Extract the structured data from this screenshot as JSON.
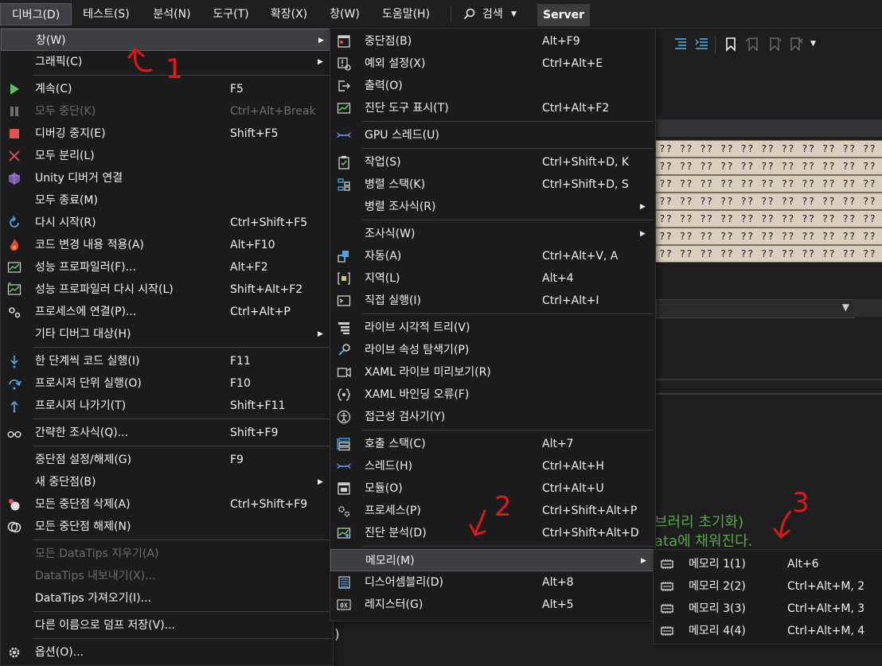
{
  "menubar": [
    {
      "label": "디버그(D)",
      "active": true
    },
    {
      "label": "테스트(S)"
    },
    {
      "label": "분석(N)"
    },
    {
      "label": "도구(T)"
    },
    {
      "label": "확장(X)"
    },
    {
      "label": "창(W)"
    },
    {
      "label": "도움말(H)"
    }
  ],
  "search_label": "검색",
  "server_label": "Server",
  "background": {
    "mem_row_text": "?? ?? ?? ?? ?? ?? ?? ?? ?? ?? ?? ?? ?? ?? ?? ?? ?? ?? ??",
    "green_line1": "브러리 초기화)",
    "green_line2": "ata에 채워진다.",
    "paren": ")"
  },
  "debug_menu": [
    {
      "label": "창(W)",
      "arrow": true,
      "highlight": true,
      "icon": ""
    },
    {
      "label": "그래픽(C)",
      "arrow": true,
      "icon": ""
    },
    {
      "sep": true
    },
    {
      "label": "계속(C)",
      "key": "F5",
      "icon": "play-icon"
    },
    {
      "label": "모두 중단(K)",
      "key": "Ctrl+Alt+Break",
      "icon": "pause-icon",
      "disabled": true
    },
    {
      "label": "디버깅 중지(E)",
      "key": "Shift+F5",
      "icon": "stop-icon"
    },
    {
      "label": "모두 분리(L)",
      "key": "",
      "icon": "detach-icon"
    },
    {
      "label": "Unity 디버거 연결",
      "key": "",
      "icon": "unity-cube-icon"
    },
    {
      "label": "모두 종료(M)",
      "key": "",
      "icon": ""
    },
    {
      "label": "다시 시작(R)",
      "key": "Ctrl+Shift+F5",
      "icon": "restart-icon"
    },
    {
      "label": "코드 변경 내용 적용(A)",
      "key": "Alt+F10",
      "icon": "hot-reload-flame-icon"
    },
    {
      "label": "성능 프로파일러(F)...",
      "key": "Alt+F2",
      "icon": "profiler-icon"
    },
    {
      "label": "성능 프로파일러 다시 시작(L)",
      "key": "Shift+Alt+F2",
      "icon": "profiler-restart-icon"
    },
    {
      "label": "프로세스에 연결(P)...",
      "key": "Ctrl+Alt+P",
      "icon": "attach-gears-icon"
    },
    {
      "label": "기타 디버그 대상(H)",
      "arrow": true,
      "icon": ""
    },
    {
      "sep": true
    },
    {
      "label": "한 단계씩 코드 실행(I)",
      "key": "F11",
      "icon": "step-into-icon"
    },
    {
      "label": "프로시저 단위 실행(O)",
      "key": "F10",
      "icon": "step-over-icon"
    },
    {
      "label": "프로시저 나가기(T)",
      "key": "Shift+F11",
      "icon": "step-out-icon"
    },
    {
      "sep": true
    },
    {
      "label": "간략한 조사식(Q)...",
      "key": "Shift+F9",
      "icon": "glasses-icon"
    },
    {
      "sep": true
    },
    {
      "label": "중단점 설정/해제(G)",
      "key": "F9",
      "icon": ""
    },
    {
      "label": "새 중단점(B)",
      "arrow": true,
      "icon": ""
    },
    {
      "label": "모든 중단점 삭제(A)",
      "key": "Ctrl+Shift+F9",
      "icon": "delete-breakpoints-icon"
    },
    {
      "label": "모든 중단점 해제(N)",
      "key": "",
      "icon": "disable-breakpoints-icon"
    },
    {
      "sep": true
    },
    {
      "label": "모든 DataTips 지우기(A)",
      "key": "",
      "icon": "",
      "disabled": true
    },
    {
      "label": "DataTips 내보내기(X)...",
      "key": "",
      "icon": "",
      "disabled": true
    },
    {
      "label": "DataTips 가져오기(I)...",
      "key": "",
      "icon": ""
    },
    {
      "sep": true
    },
    {
      "label": "다른 이름으로 덤프 저장(V)...",
      "key": "",
      "icon": ""
    },
    {
      "sep": true
    },
    {
      "label": "옵션(O)...",
      "key": "",
      "icon": "settings-gear-icon"
    }
  ],
  "window_menu": [
    {
      "label": "중단점(B)",
      "key": "Alt+F9",
      "icon": "breakpoints-window-icon"
    },
    {
      "label": "예외 설정(X)",
      "key": "Ctrl+Alt+E",
      "icon": "exception-settings-icon"
    },
    {
      "label": "출력(O)",
      "key": "",
      "icon": "output-icon"
    },
    {
      "label": "진단 도구 표시(T)",
      "key": "Ctrl+Alt+F2",
      "icon": "diagnostic-tools-icon"
    },
    {
      "sep": true
    },
    {
      "label": "GPU 스레드(U)",
      "key": "",
      "icon": "gpu-threads-icon"
    },
    {
      "sep": true
    },
    {
      "label": "작업(S)",
      "key": "Ctrl+Shift+D, K",
      "icon": "tasks-icon"
    },
    {
      "label": "병렬 스택(K)",
      "key": "Ctrl+Shift+D, S",
      "icon": "parallel-stacks-icon"
    },
    {
      "label": "병렬 조사식(R)",
      "arrow": true,
      "icon": ""
    },
    {
      "sep": true
    },
    {
      "label": "조사식(W)",
      "arrow": true,
      "icon": ""
    },
    {
      "label": "자동(A)",
      "key": "Ctrl+Alt+V, A",
      "icon": "autos-icon"
    },
    {
      "label": "지역(L)",
      "key": "Alt+4",
      "icon": "locals-icon"
    },
    {
      "label": "직접 실행(I)",
      "key": "Ctrl+Alt+I",
      "icon": "immediate-window-icon"
    },
    {
      "sep": true
    },
    {
      "label": "라이브 시각적 트리(V)",
      "key": "",
      "icon": "live-visual-tree-icon"
    },
    {
      "label": "라이브 속성 탐색기(P)",
      "key": "",
      "icon": "property-explorer-icon"
    },
    {
      "label": "XAML 라이브 미리보기(R)",
      "key": "",
      "icon": "xaml-preview-icon"
    },
    {
      "label": "XAML 바인딩 오류(F)",
      "key": "",
      "icon": "xaml-binding-icon"
    },
    {
      "label": "접근성 검사기(Y)",
      "key": "",
      "icon": "accessibility-icon"
    },
    {
      "sep": true
    },
    {
      "label": "호출 스택(C)",
      "key": "Alt+7",
      "icon": "call-stack-icon"
    },
    {
      "label": "스레드(H)",
      "key": "Ctrl+Alt+H",
      "icon": "threads-icon"
    },
    {
      "label": "모듈(O)",
      "key": "Ctrl+Alt+U",
      "icon": "modules-icon"
    },
    {
      "label": "프로세스(P)",
      "key": "Ctrl+Shift+Alt+P",
      "icon": "processes-icon"
    },
    {
      "label": "진단 분석(D)",
      "key": "Ctrl+Shift+Alt+D",
      "icon": "diagnostic-analysis-icon"
    },
    {
      "sep": true
    },
    {
      "label": "메모리(M)",
      "arrow": true,
      "highlight": true,
      "icon": ""
    },
    {
      "label": "디스어셈블리(D)",
      "key": "Alt+8",
      "icon": "disassembly-icon"
    },
    {
      "label": "레지스터(G)",
      "key": "Alt+5",
      "icon": "registers-icon"
    }
  ],
  "memory_menu": [
    {
      "label": "메모리 1(1)",
      "key": "Alt+6",
      "icon": "memory-chip-icon"
    },
    {
      "label": "메모리 2(2)",
      "key": "Ctrl+Alt+M, 2",
      "icon": "memory-chip-icon"
    },
    {
      "label": "메모리 3(3)",
      "key": "Ctrl+Alt+M, 3",
      "icon": "memory-chip-icon"
    },
    {
      "label": "메모리 4(4)",
      "key": "Ctrl+Alt+M, 4",
      "icon": "memory-chip-icon"
    }
  ],
  "annotations": [
    "1",
    "2",
    "3"
  ]
}
